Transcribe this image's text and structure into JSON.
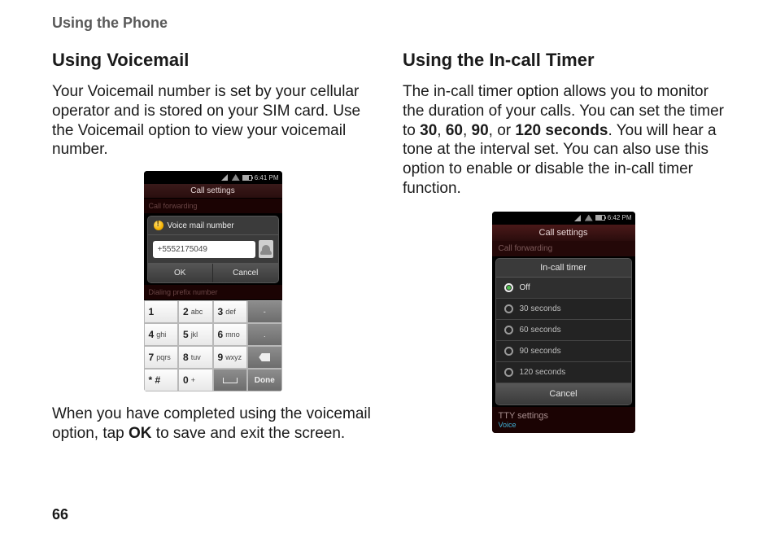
{
  "header": "Using the Phone",
  "page_number": "66",
  "left": {
    "title": "Using Voicemail",
    "p1": "Your Voicemail number is set by your cellular operator and is stored on your SIM card. Use the Voicemail option to view your voicemail number.",
    "p2_a": "When you have completed using the voicemail option, tap ",
    "p2_bold": "OK",
    "p2_b": " to save and exit the screen."
  },
  "right": {
    "title": "Using the In-call Timer",
    "p1_a": "The in-call timer option allows you to monitor the duration of your calls. You can set the timer to ",
    "p1_b1": "30",
    "p1_s1": ", ",
    "p1_b2": "60",
    "p1_s2": ", ",
    "p1_b3": "90",
    "p1_s3": ", or ",
    "p1_b4": "120 seconds",
    "p1_c": ". You will hear a tone at the interval set. You can also use this option to enable or disable the in-call timer function."
  },
  "shot1": {
    "time": "6:41 PM",
    "screen_title": "Call settings",
    "bg_item": "Call forwarding",
    "dialog_title": "Voice mail number",
    "phone_value": "+5552175049",
    "ok": "OK",
    "cancel": "Cancel",
    "bg_item2": "Dialing prefix number",
    "keys": {
      "k1n": "1",
      "k1l": "",
      "k2n": "2",
      "k2l": "abc",
      "k3n": "3",
      "k3l": "def",
      "k4n": "4",
      "k4l": "ghi",
      "k5n": "5",
      "k5l": "jkl",
      "k6n": "6",
      "k6l": "mno",
      "k7n": "7",
      "k7l": "pqrs",
      "k8n": "8",
      "k8l": "tuv",
      "k9n": "9",
      "k9l": "wxyz",
      "kstar": "* #",
      "k0n": "0",
      "k0l": "+",
      "kdash": "-",
      "done": "Done"
    }
  },
  "shot2": {
    "time": "6:42 PM",
    "screen_title": "Call settings",
    "bg_item_top": "Call forwarding",
    "dialog_title": "In-call timer",
    "opts": {
      "off": "Off",
      "t30": "30 seconds",
      "t60": "60 seconds",
      "t90": "90 seconds",
      "t120": "120 seconds"
    },
    "cancel": "Cancel",
    "bg_item_bottom": "TTY settings",
    "bg_item_bottom_sub": "Voice"
  }
}
